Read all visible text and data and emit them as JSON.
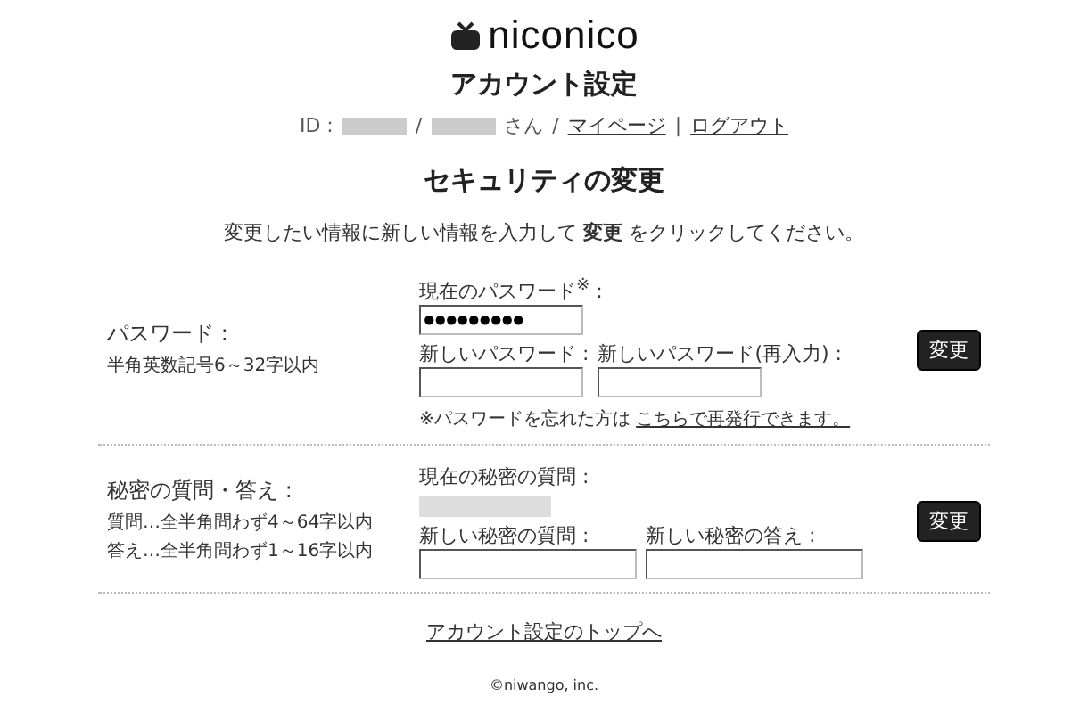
{
  "logo": {
    "text": "niconico"
  },
  "title": "アカウント設定",
  "user_line": {
    "id_label": "ID :",
    "separator": "/",
    "san": "さん",
    "separator2": "/",
    "links": [
      "マイページ",
      "ログアウト"
    ],
    "divider": "|"
  },
  "heading": "セキュリティの変更",
  "instruction": {
    "before": "変更したい情報に新しい情報を入力して",
    "bold": "変更",
    "after": "をクリックしてください。"
  },
  "sections": [
    {
      "kind": "password",
      "label": "パスワード :",
      "notes": [
        "半角英数記号6～32字以内"
      ],
      "current_label": "現在のパスワード$^{※}$ :",
      "current_value": "●●●●●●●●●",
      "fields": [
        {
          "label": "新しいパスワード :"
        },
        {
          "label": "新しいパスワード(再入力) :"
        }
      ],
      "note": "※パスワードを忘れた方は",
      "note_link": "こちらで再発行できます。",
      "button": "変更"
    },
    {
      "kind": "secret",
      "label": "秘密の質問・答え :",
      "notes": [
        "質問…全半角問わず4～64字以内",
        "答え…全半角問わず1～16字以内"
      ],
      "current_label": "現在の秘密の質問 :",
      "fields": [
        {
          "label": "新しい秘密の質問 :"
        },
        {
          "label": "新しい秘密の答え :"
        }
      ],
      "button": "変更"
    }
  ],
  "top_link": "アカウント設定のトップへ",
  "copyright": "©niwango, inc."
}
